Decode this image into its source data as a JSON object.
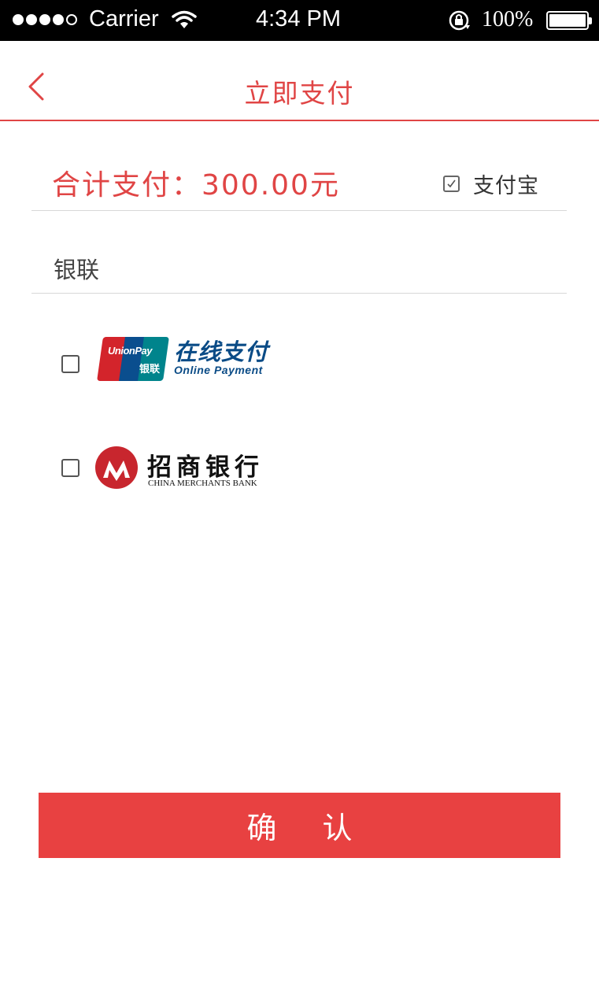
{
  "status_bar": {
    "carrier": "Carrier",
    "time": "4:34  PM",
    "battery": "100%",
    "signal_icon": "signal-dots-icon",
    "wifi_icon": "wifi-icon",
    "lock_icon": "rotation-lock-icon",
    "battery_icon": "battery-icon"
  },
  "navbar": {
    "title": "立即支付",
    "back_icon": "chevron-left-icon"
  },
  "payment": {
    "total_text": "合计支付：300.00元",
    "alipay": {
      "label": "支付宝",
      "checked": true
    }
  },
  "unionpay_section": {
    "title": "银联"
  },
  "banks": [
    {
      "name": "unionpay-online",
      "checked": false,
      "logo_word": "UnionPay",
      "logo_cn": "银联",
      "logo_title": "在线支付",
      "logo_sub": "Online Payment"
    },
    {
      "name": "china-merchants-bank",
      "checked": false,
      "logo_title": "招商银行",
      "logo_sub": "CHINA MERCHANTS BANK"
    }
  ],
  "confirm_label": "确认",
  "colors": {
    "accent": "#e04545",
    "button": "#e84141",
    "divider": "#d8d8d8",
    "status_bar": "#000000"
  }
}
